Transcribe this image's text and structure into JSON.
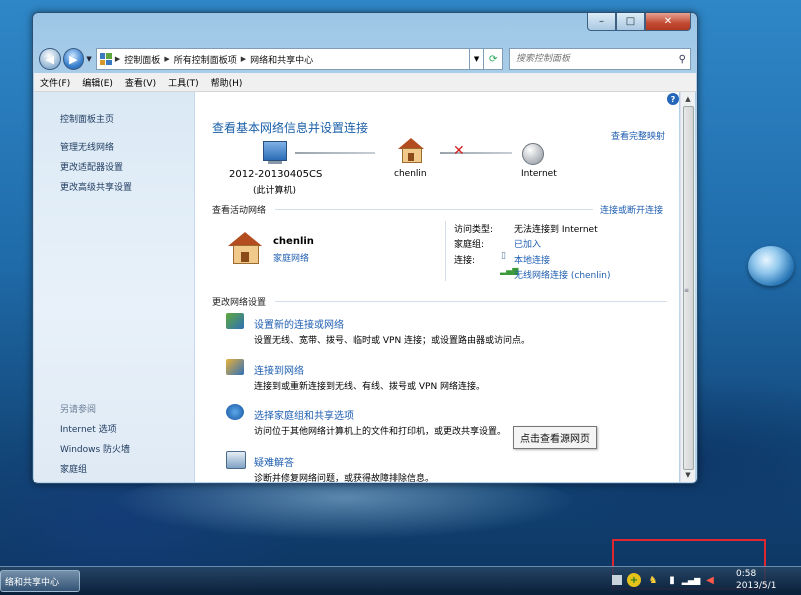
{
  "window": {
    "address": [
      "控制面板",
      "所有控制面板项",
      "网络和共享中心"
    ],
    "search_placeholder": "搜索控制面板",
    "menu": [
      "文件(F)",
      "编辑(E)",
      "查看(V)",
      "工具(T)",
      "帮助(H)"
    ]
  },
  "sidebar": {
    "links": [
      "控制面板主页",
      "管理无线网络",
      "更改适配器设置",
      "更改高级共享设置"
    ],
    "see_also_label": "另请参阅",
    "see_also": [
      "Internet 选项",
      "Windows 防火墙",
      "家庭组"
    ]
  },
  "main": {
    "title": "查看基本网络信息并设置连接",
    "full_map_link": "查看完整映射",
    "computer_name": "2012-20130405CS",
    "computer_sub": "(此计算机)",
    "router_name": "chenlin",
    "internet_name": "Internet",
    "active_label": "查看活动网络",
    "connect_disconnect_link": "连接或断开连接",
    "network_name": "chenlin",
    "network_type": "家庭网络",
    "access_type_label": "访问类型:",
    "access_type_value": "无法连接到 Internet",
    "homegroup_label": "家庭组:",
    "homegroup_value": "已加入",
    "connections_label": "连接:",
    "connection_1": "本地连接",
    "connection_2": "无线网络连接 (chenlin)",
    "change_label": "更改网络设置",
    "tasks": [
      {
        "title": "设置新的连接或网络",
        "desc": "设置无线、宽带、拨号、临时或 VPN 连接；或设置路由器或访问点。"
      },
      {
        "title": "连接到网络",
        "desc": "连接到或重新连接到无线、有线、拨号或 VPN 网络连接。"
      },
      {
        "title": "选择家庭组和共享选项",
        "desc": "访问位于其他网络计算机上的文件和打印机，或更改共享设置。"
      },
      {
        "title": "疑难解答",
        "desc": "诊断并修复网络问题，或获得故障排除信息。"
      }
    ]
  },
  "tooltip": "点击查看源网页",
  "taskbar": {
    "active_item": "络和共享中心",
    "time": "0:58",
    "date": "2013/5/1"
  }
}
